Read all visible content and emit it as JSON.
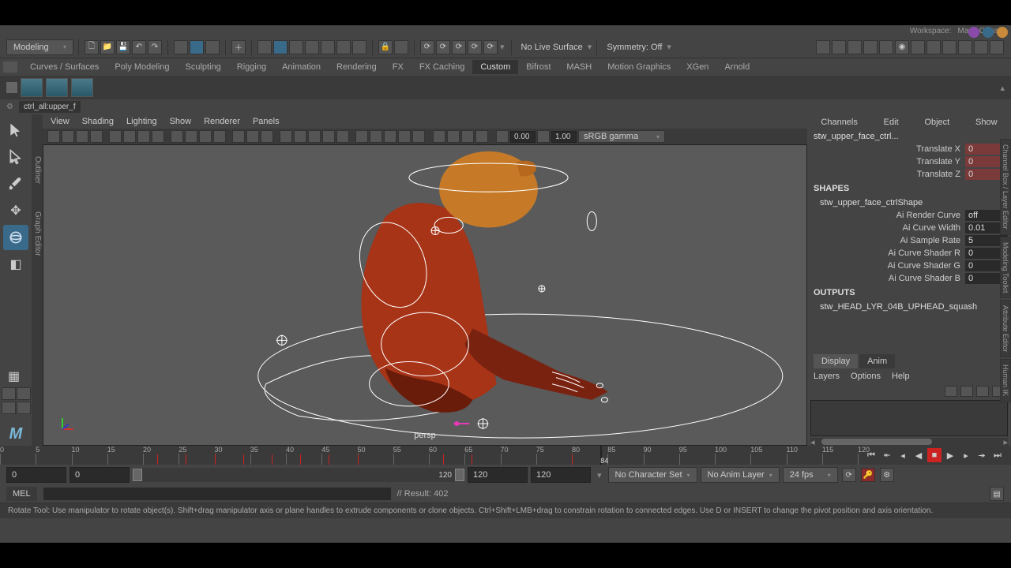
{
  "topbar": {
    "workspace_label": "Workspace:",
    "workspace_value": "Maya Classic"
  },
  "toolbar": {
    "mode": "Modeling",
    "live_surface": "No Live Surface",
    "symmetry": "Symmetry: Off"
  },
  "shelf_tabs": [
    "Curves / Surfaces",
    "Poly Modeling",
    "Sculpting",
    "Rigging",
    "Animation",
    "Rendering",
    "FX",
    "FX Caching",
    "Custom",
    "Bifrost",
    "MASH",
    "Motion Graphics",
    "XGen",
    "Arnold"
  ],
  "shelf_active": "Custom",
  "breadcrumb": "ctrl_all:upper_f",
  "panel_menu": [
    "View",
    "Shading",
    "Lighting",
    "Show",
    "Renderer",
    "Panels"
  ],
  "panel_vals": {
    "near": "0.00",
    "far": "1.00",
    "colorspace": "sRGB gamma"
  },
  "viewport": {
    "camera": "persp"
  },
  "channel_box": {
    "menu": [
      "Channels",
      "Edit",
      "Object",
      "Show"
    ],
    "node": "stw_upper_face_ctrl...",
    "attrs": [
      {
        "label": "Translate X",
        "value": "0",
        "locked": true
      },
      {
        "label": "Translate Y",
        "value": "0",
        "locked": true
      },
      {
        "label": "Translate Z",
        "value": "0",
        "locked": true
      }
    ],
    "shapes_header": "SHAPES",
    "shape_node": "stw_upper_face_ctrlShape",
    "shape_attrs": [
      {
        "label": "Ai Render Curve",
        "value": "off"
      },
      {
        "label": "Ai Curve Width",
        "value": "0.01"
      },
      {
        "label": "Ai Sample Rate",
        "value": "5"
      },
      {
        "label": "Ai Curve Shader R",
        "value": "0"
      },
      {
        "label": "Ai Curve Shader G",
        "value": "0"
      },
      {
        "label": "Ai Curve Shader B",
        "value": "0"
      }
    ],
    "outputs_header": "OUTPUTS",
    "output_node": "stw_HEAD_LYR_04B_UPHEAD_squash"
  },
  "layers": {
    "tabs": [
      "Display",
      "Anim"
    ],
    "menu": [
      "Layers",
      "Options",
      "Help"
    ]
  },
  "timeline": {
    "ticks": [
      0,
      5,
      10,
      15,
      20,
      25,
      30,
      35,
      40,
      45,
      50,
      55,
      60,
      65,
      70,
      75,
      80,
      85,
      90,
      95,
      100,
      105,
      110,
      115,
      120
    ],
    "current": 84,
    "keys": [
      22,
      26,
      30,
      34,
      38,
      42,
      46,
      50,
      62,
      66,
      80
    ],
    "start": "0",
    "range_start": "0",
    "range_end": "120",
    "end": "120",
    "end2": "120",
    "char_set": "No Character Set",
    "anim_layer": "No Anim Layer",
    "fps": "24 fps"
  },
  "cmd": {
    "lang": "MEL",
    "result": "// Result: 402"
  },
  "help": "Rotate Tool: Use manipulator to rotate object(s). Shift+drag manipulator axis or plane handles to extrude components or clone objects. Ctrl+Shift+LMB+drag to constrain rotation to connected edges. Use D or INSERT to change the pivot position and axis orientation.",
  "side_tabs": {
    "outliner": "Outliner",
    "graph": "Graph Editor"
  },
  "right_tabs": [
    "Channel Box / Layer Editor",
    "Modeling Toolkit",
    "Attribute Editor",
    "Human IK"
  ]
}
